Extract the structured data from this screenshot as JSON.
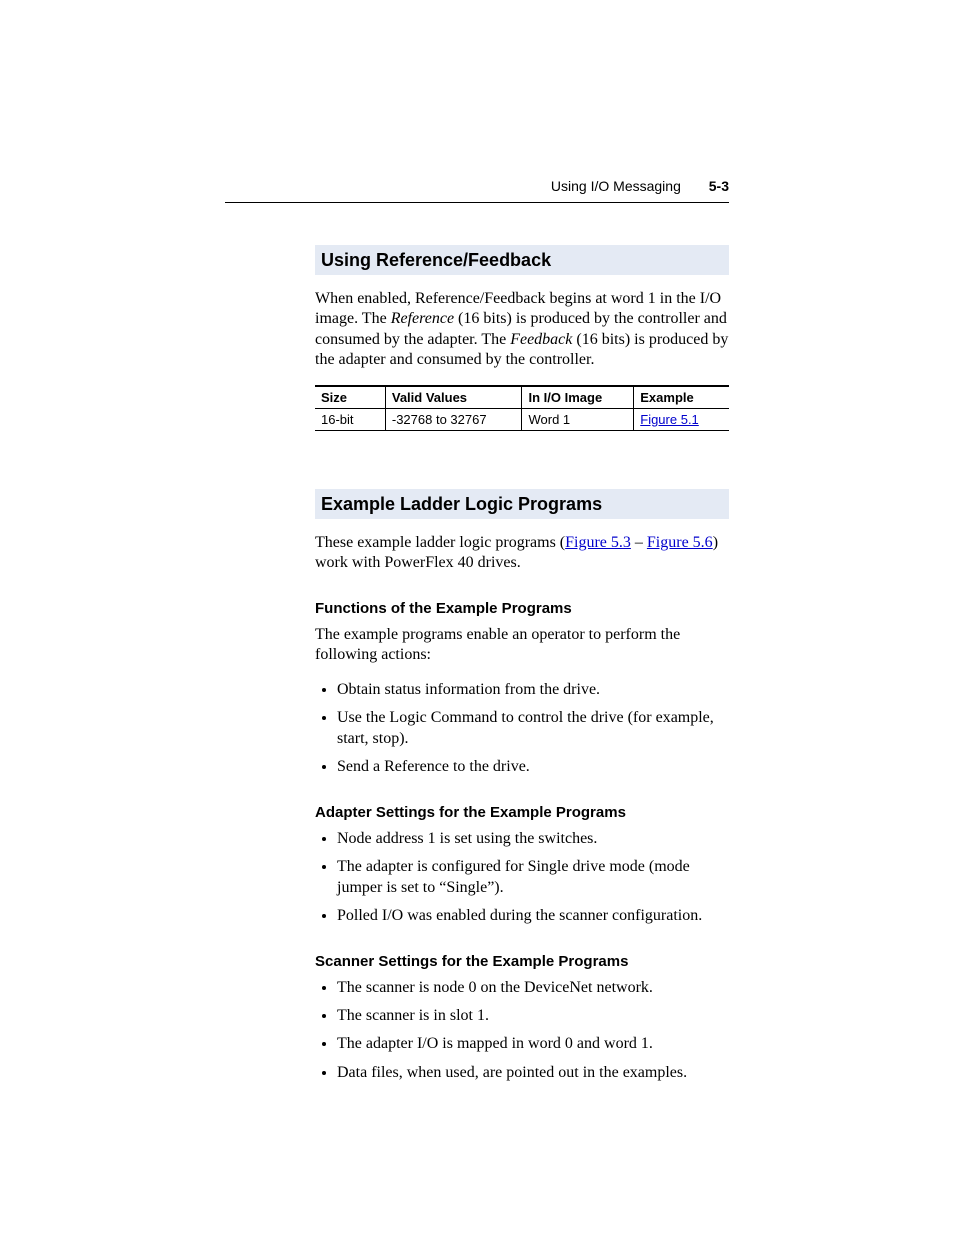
{
  "header": {
    "section_title": "Using I/O Messaging",
    "page_number": "5-3"
  },
  "sec1": {
    "heading": "Using Reference/Feedback",
    "para_a": "When enabled, Reference/Feedback begins at word 1 in the I/O image. The ",
    "para_b": "Reference",
    "para_c": " (16 bits) is produced by the controller and consumed by the adapter. The ",
    "para_d": "Feedback",
    "para_e": " (16 bits) is produced by the adapter and consumed by the controller.",
    "table": {
      "h1": "Size",
      "h2": "Valid Values",
      "h3": "In I/O Image",
      "h4": "Example",
      "r1c1": "16-bit",
      "r1c2": "-32768 to 32767",
      "r1c3": "Word 1",
      "r1c4": "Figure 5.1"
    }
  },
  "sec2": {
    "heading": "Example Ladder Logic Programs",
    "intro_a": "These example ladder logic programs (",
    "intro_link1": "Figure 5.3",
    "intro_mid": " – ",
    "intro_link2": "Figure 5.6",
    "intro_b": ") work with PowerFlex 40 drives.",
    "sub1": {
      "heading": "Functions of the Example Programs",
      "lead": "The example programs enable an operator to perform the following actions:",
      "items": {
        "0": "Obtain status information from the drive.",
        "1": "Use the Logic Command to control the drive (for example, start, stop).",
        "2": "Send a Reference to the drive."
      }
    },
    "sub2": {
      "heading": "Adapter Settings for the Example Programs",
      "items": {
        "0": "Node address 1 is set using the switches.",
        "1": "The adapter is configured for Single drive mode (mode jumper is set to “Single”).",
        "2": "Polled I/O was enabled during the scanner configuration."
      }
    },
    "sub3": {
      "heading": "Scanner Settings for the Example Programs",
      "items": {
        "0": "The scanner is node 0 on the DeviceNet network.",
        "1": "The scanner is in slot 1.",
        "2": "The adapter I/O is mapped in word 0 and word 1.",
        "3": "Data files, when used, are pointed out in the examples."
      }
    }
  }
}
